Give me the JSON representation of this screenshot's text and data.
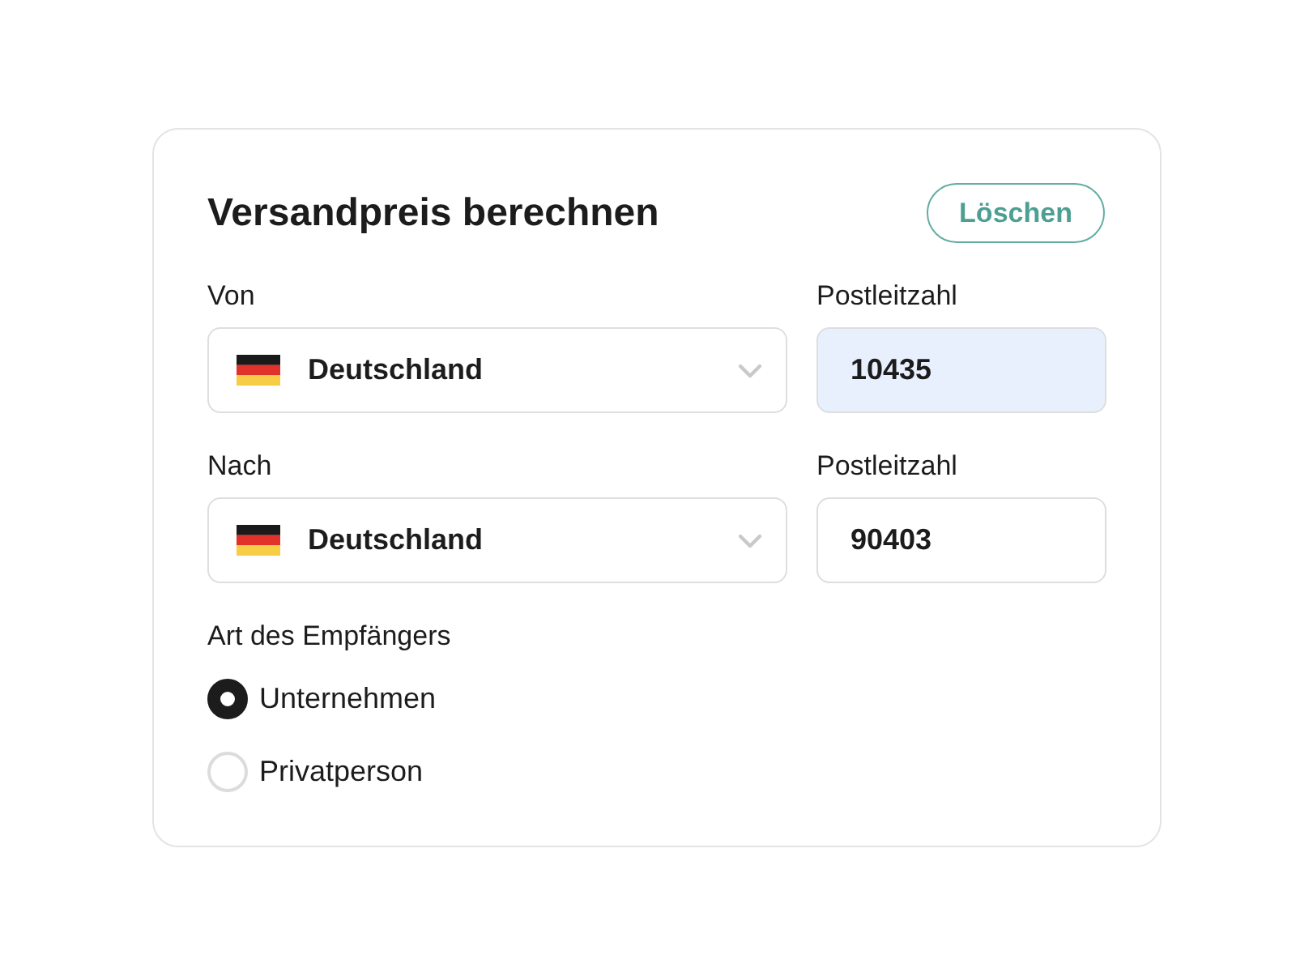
{
  "form": {
    "title": "Versandpreis berechnen",
    "clear_button": "Löschen"
  },
  "routes": [
    {
      "label": "Von",
      "country": "Deutschland",
      "postcode_label": "Postleitzahl",
      "postcode": "10435",
      "autofilled": true
    },
    {
      "label": "Nach",
      "country": "Deutschland",
      "postcode_label": "Postleitzahl",
      "postcode": "90403",
      "autofilled": false
    }
  ],
  "recipient_type": {
    "label": "Art des Empfängers",
    "options": [
      {
        "label": "Unternehmen",
        "selected": true
      },
      {
        "label": "Privatperson",
        "selected": false
      }
    ]
  }
}
